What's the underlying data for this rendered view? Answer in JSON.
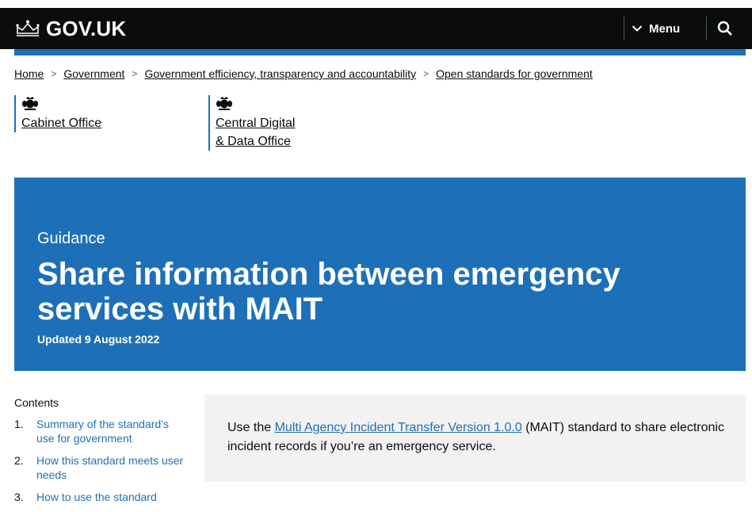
{
  "header": {
    "logo_text": "GOV.UK",
    "menu_label": "Menu",
    "icons": {
      "logo": "crown-icon",
      "menu": "chevron-down-icon",
      "search": "search-icon"
    }
  },
  "breadcrumb": [
    {
      "label": "Home"
    },
    {
      "label": "Government"
    },
    {
      "label": "Government efficiency, transparency and accountability"
    },
    {
      "label": "Open standards for government"
    }
  ],
  "organisations": [
    {
      "line1": "Cabinet Office",
      "line2": ""
    },
    {
      "line1": "Central Digital",
      "line2": "& Data Office"
    }
  ],
  "title_block": {
    "document_type": "Guidance",
    "title": "Share information between emergency services with MAIT",
    "updated": "Updated 9 August 2022"
  },
  "contents": {
    "label": "Contents",
    "items": [
      {
        "number": "1.",
        "label": "Summary of the standard’s use for government"
      },
      {
        "number": "2.",
        "label": "How this standard meets user needs"
      },
      {
        "number": "3.",
        "label": "How to use the standard"
      }
    ]
  },
  "summary": {
    "before": "Use the ",
    "link": "Multi Agency Incident Transfer Version 1.0.0",
    "after": " (MAIT) standard to share electronic incident records if you’re an emergency service."
  },
  "colors": {
    "header": "#0b0c0c",
    "brand_blue": "#1d70b8",
    "summary_bg": "#f3f2f1"
  }
}
